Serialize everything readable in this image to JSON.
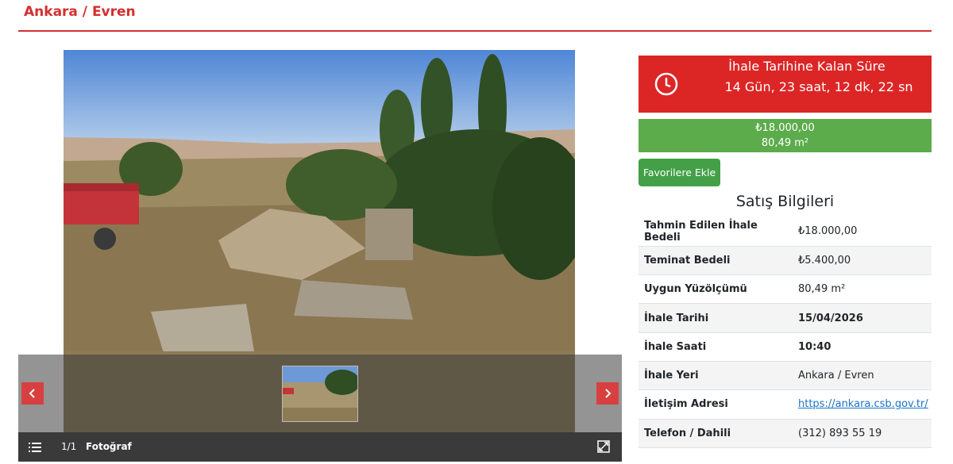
{
  "header": {
    "title": "Ankara / Evren"
  },
  "gallery": {
    "counter": "1/1",
    "label": "Fotoğraf",
    "icons": {
      "list": "list-icon",
      "expand": "expand-icon",
      "prev": "chevron-left-icon",
      "next": "chevron-right-icon"
    }
  },
  "countdown": {
    "title": "İhale Tarihine Kalan Süre",
    "value": "14 Gün, 23 saat, 12 dk, 22 sn",
    "icon": "clock-icon",
    "color": "#dc2626"
  },
  "price": {
    "amount": "₺18.000,00",
    "area": "80,49 m²",
    "color": "#5cac4c"
  },
  "favorite_button": {
    "label": "Favorilere Ekle"
  },
  "sales": {
    "title": "Satış Bilgileri",
    "rows": [
      {
        "label": "Tahmin Edilen İhale Bedeli",
        "value": "₺18.000,00"
      },
      {
        "label": "Teminat Bedeli",
        "value": "₺5.400,00"
      },
      {
        "label": "Uygun Yüzölçümü",
        "value": "80,49 m²"
      },
      {
        "label": "İhale Tarihi",
        "value": "15/04/2026"
      },
      {
        "label": "İhale Saati",
        "value": "10:40"
      },
      {
        "label": "İhale Yeri",
        "value": "Ankara / Evren"
      },
      {
        "label": "İletişim Adresi",
        "value": "https://ankara.csb.gov.tr/"
      },
      {
        "label": "Telefon / Dahili",
        "value": "(312) 893 55 19"
      }
    ]
  },
  "colors": {
    "accent": "#d32f2f"
  }
}
